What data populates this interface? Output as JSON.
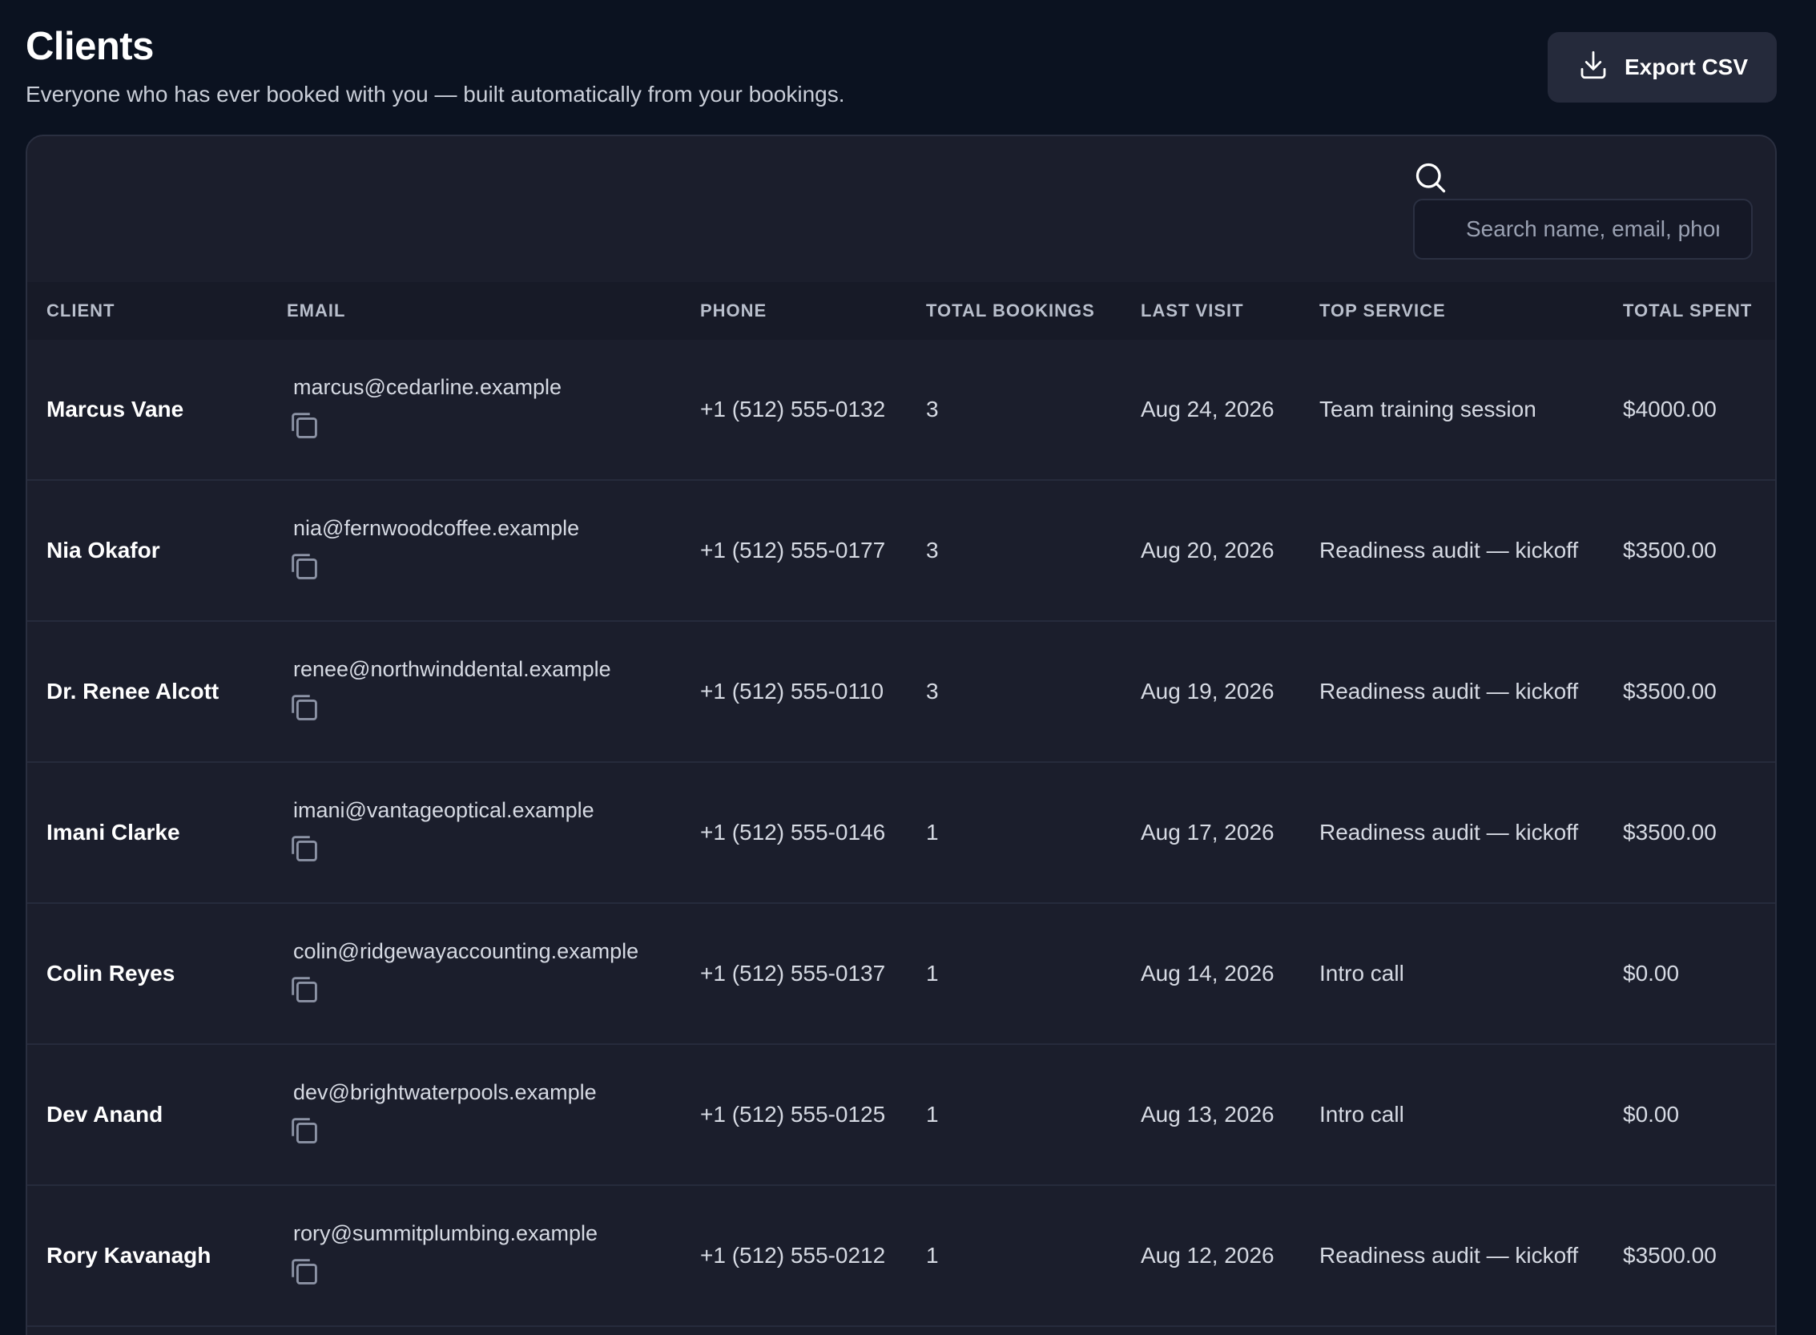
{
  "header": {
    "title": "Clients",
    "subtitle": "Everyone who has ever booked with you — built automatically from your bookings.",
    "export_label": "Export CSV"
  },
  "search": {
    "placeholder": "Search name, email, phone"
  },
  "table": {
    "columns": [
      "CLIENT",
      "EMAIL",
      "PHONE",
      "TOTAL BOOKINGS",
      "LAST VISIT",
      "TOP SERVICE",
      "TOTAL SPENT"
    ],
    "rows": [
      {
        "client": "Marcus Vane",
        "email": "marcus@cedarline.example",
        "phone": "+1 (512) 555-0132",
        "total_bookings": "3",
        "last_visit": "Aug 24, 2026",
        "top_service": "Team training session",
        "total_spent": "$4000.00"
      },
      {
        "client": "Nia Okafor",
        "email": "nia@fernwoodcoffee.example",
        "phone": "+1 (512) 555-0177",
        "total_bookings": "3",
        "last_visit": "Aug 20, 2026",
        "top_service": "Readiness audit — kickoff",
        "total_spent": "$3500.00"
      },
      {
        "client": "Dr. Renee Alcott",
        "email": "renee@northwinddental.example",
        "phone": "+1 (512) 555-0110",
        "total_bookings": "3",
        "last_visit": "Aug 19, 2026",
        "top_service": "Readiness audit — kickoff",
        "total_spent": "$3500.00"
      },
      {
        "client": "Imani Clarke",
        "email": "imani@vantageoptical.example",
        "phone": "+1 (512) 555-0146",
        "total_bookings": "1",
        "last_visit": "Aug 17, 2026",
        "top_service": "Readiness audit — kickoff",
        "total_spent": "$3500.00"
      },
      {
        "client": "Colin Reyes",
        "email": "colin@ridgewayaccounting.example",
        "phone": "+1 (512) 555-0137",
        "total_bookings": "1",
        "last_visit": "Aug 14, 2026",
        "top_service": "Intro call",
        "total_spent": "$0.00"
      },
      {
        "client": "Dev Anand",
        "email": "dev@brightwaterpools.example",
        "phone": "+1 (512) 555-0125",
        "total_bookings": "1",
        "last_visit": "Aug 13, 2026",
        "top_service": "Intro call",
        "total_spent": "$0.00"
      },
      {
        "client": "Rory Kavanagh",
        "email": "rory@summitplumbing.example",
        "phone": "+1 (512) 555-0212",
        "total_bookings": "1",
        "last_visit": "Aug 12, 2026",
        "top_service": "Readiness audit — kickoff",
        "total_spent": "$3500.00"
      }
    ]
  },
  "icons": {
    "export": "download-icon",
    "search": "search-icon",
    "copy": "copy-icon"
  }
}
